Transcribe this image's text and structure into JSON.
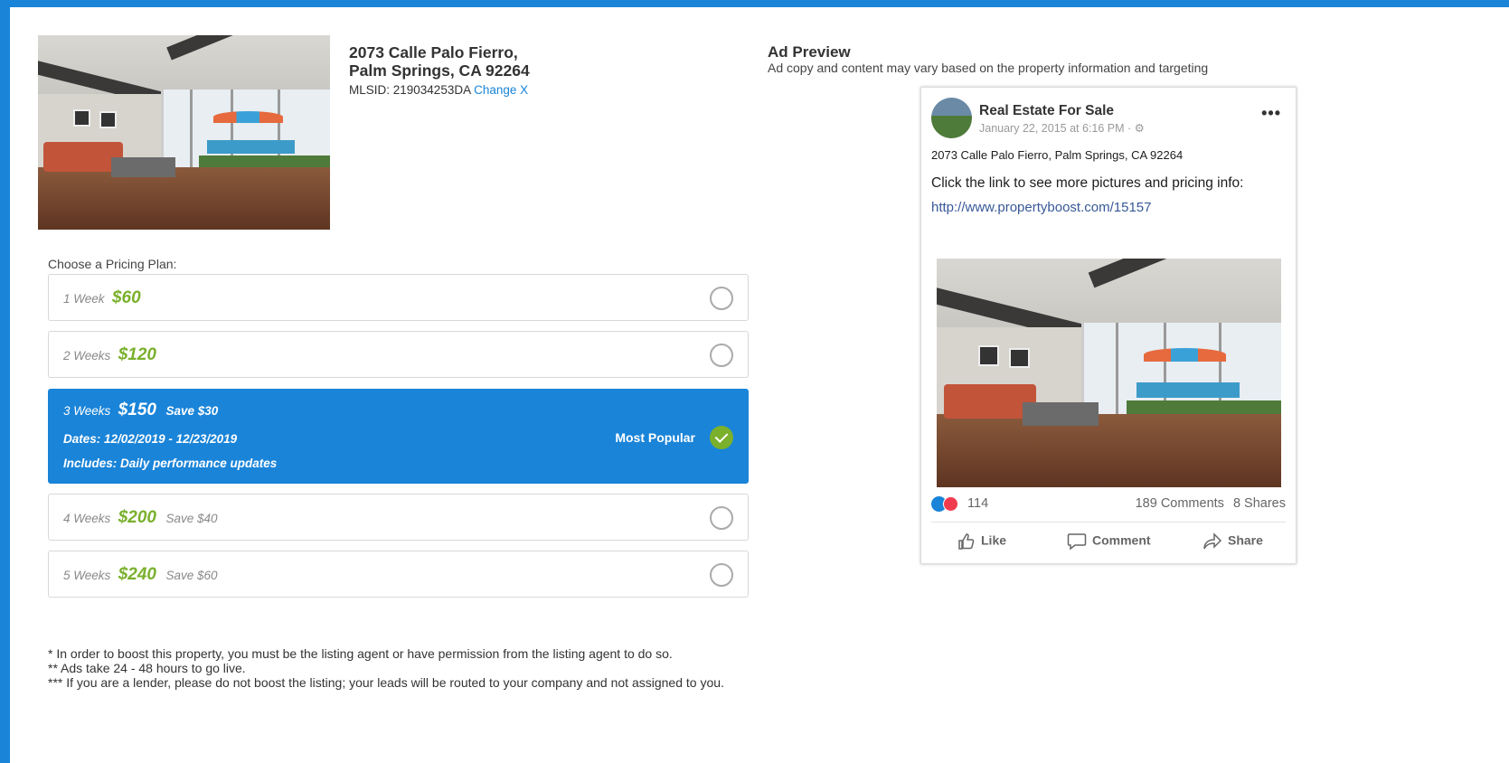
{
  "property": {
    "address_line1": "2073 Calle Palo Fierro,",
    "address_line2": "Palm Springs, CA 92264",
    "mlsid_label": "MLSID: 219034253DA",
    "change_link": "Change X"
  },
  "pricing": {
    "heading": "Choose a Pricing Plan:",
    "plans": [
      {
        "duration": "1 Week",
        "price": "$60",
        "save": ""
      },
      {
        "duration": "2 Weeks",
        "price": "$120",
        "save": ""
      },
      {
        "duration": "3 Weeks",
        "price": "$150",
        "save": "Save $30",
        "dates": "Dates: 12/02/2019 - 12/23/2019",
        "includes": "Includes: Daily performance updates",
        "badge": "Most Popular"
      },
      {
        "duration": "4 Weeks",
        "price": "$200",
        "save": "Save $40"
      },
      {
        "duration": "5 Weeks",
        "price": "$240",
        "save": "Save $60"
      }
    ],
    "selected_index": 2
  },
  "notes": [
    "* In order to boost this property, you must be the listing agent or have permission from the listing agent to do so.",
    "** Ads take 24 - 48 hours to go live.",
    "*** If you are a lender, please do not boost the listing; your leads will be routed to your company and not assigned to you."
  ],
  "ad_preview": {
    "title": "Ad Preview",
    "subtitle": "Ad copy and content may vary based on the property information and targeting",
    "post": {
      "page_name": "Real Estate For Sale",
      "date": "January 22, 2015 at 6:16 PM · ⚙",
      "address": "2073 Calle Palo Fierro, Palm Springs, CA 92264",
      "cta": "Click the link to see more pictures and pricing info:",
      "link": "http://www.propertyboost.com/15157",
      "reaction_count": "114",
      "comments": "189 Comments",
      "shares": "8 Shares",
      "actions": {
        "like": "Like",
        "comment": "Comment",
        "share": "Share"
      }
    }
  },
  "colors": {
    "accent": "#1a84d8",
    "price_green": "#7ab02c",
    "fb_link": "#385898"
  }
}
